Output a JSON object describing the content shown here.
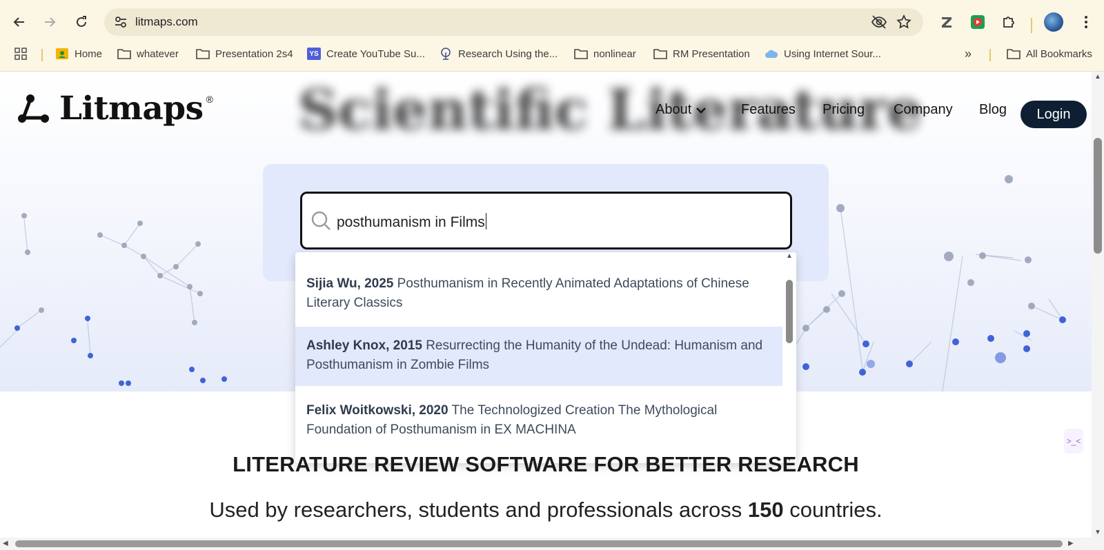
{
  "browser": {
    "url": "litmaps.com",
    "bookmarks": [
      {
        "label": "Home",
        "icon": "classroom-icon"
      },
      {
        "label": "whatever",
        "icon": "folder-icon"
      },
      {
        "label": "Presentation 2s4",
        "icon": "folder-icon"
      },
      {
        "label": "Create YouTube Su...",
        "icon": "ys-icon"
      },
      {
        "label": "Research Using the...",
        "icon": "tree-logo-icon"
      },
      {
        "label": "nonlinear",
        "icon": "folder-icon"
      },
      {
        "label": "RM Presentation",
        "icon": "folder-icon"
      },
      {
        "label": "Using Internet Sour...",
        "icon": "cloud-icon"
      }
    ],
    "all_bookmarks": "All Bookmarks",
    "ys_badge": "YS",
    "more": "»"
  },
  "site": {
    "logo": "Litmaps",
    "logo_mark": "®",
    "blurred_title": "Scientific Literature",
    "nav": {
      "about": "About",
      "features": "Features",
      "pricing": "Pricing",
      "company": "Company",
      "blog": "Blog",
      "login": "Login"
    },
    "search": {
      "value": "posthumanism in Films"
    },
    "suggestions": [
      {
        "author": "Sijia Wu, 2025",
        "title": "Posthumanism in Recently Animated Adaptations of Chinese Literary Classics"
      },
      {
        "author": "Ashley Knox, 2015",
        "title": "Resurrecting the Humanity of the Undead: Humanism and Posthumanism in Zombie Films"
      },
      {
        "author": "Felix Woitkowski, 2020",
        "title": "The Technologized Creation The Mythological Foundation of Posthumanism in EX MACHINA"
      }
    ],
    "headline": "LITERATURE REVIEW SOFTWARE FOR BETTER RESEARCH",
    "tagline_pre": "Used by researchers, students and professionals across",
    "tagline_count": "150",
    "tagline_post": "countries.",
    "side_badge": ">_<"
  },
  "colors": {
    "chrome_bg": "#fcf6e4",
    "search_panel": "#e3e9fc",
    "login_bg": "#0f1f33",
    "network_dots": "#3f63d8"
  }
}
